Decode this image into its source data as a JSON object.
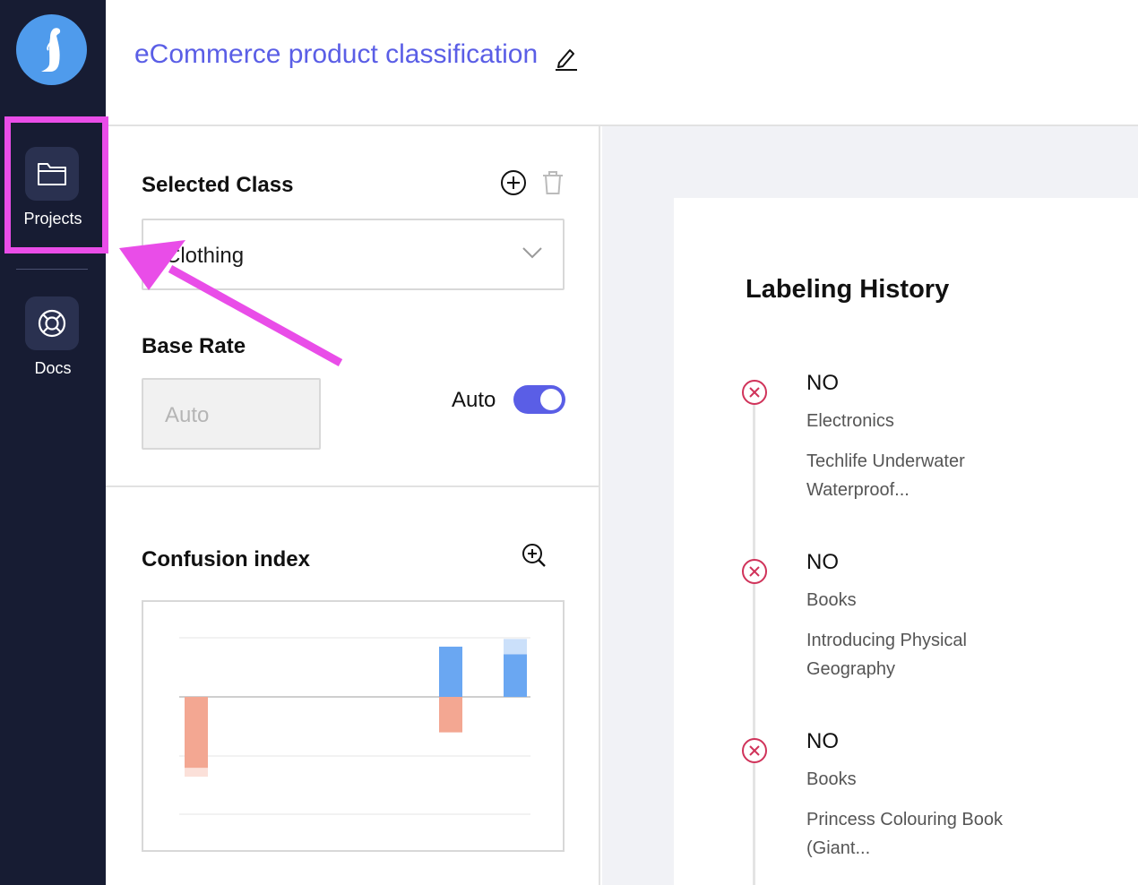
{
  "sidebar": {
    "nav": [
      {
        "label": "Projects",
        "icon": "folder-icon"
      },
      {
        "label": "Docs",
        "icon": "lifebuoy-icon"
      }
    ]
  },
  "header": {
    "title": "eCommerce product classification"
  },
  "selected_class": {
    "title": "Selected Class",
    "value": "Clothing"
  },
  "base_rate": {
    "title": "Base Rate",
    "placeholder": "Auto",
    "toggle_label": "Auto",
    "toggle_on": true
  },
  "confusion": {
    "title": "Confusion index"
  },
  "chart_data": {
    "type": "bar",
    "bars": [
      {
        "value": -1.2,
        "faint": -0.15,
        "color": "#f3a792"
      },
      {
        "value": 0.85,
        "faint": 0,
        "color": "#6aa7f2"
      },
      {
        "value": -0.6,
        "faint": 0,
        "color": "#f3a792"
      },
      {
        "value": 0.72,
        "faint": 0.26,
        "color": "#6aa7f2"
      }
    ]
  },
  "history": {
    "title": "Labeling History",
    "items": [
      {
        "verdict": "NO",
        "class": "Electronics",
        "name": "Techlife Underwater Waterproof..."
      },
      {
        "verdict": "NO",
        "class": "Books",
        "name": "Introducing Physical Geography"
      },
      {
        "verdict": "NO",
        "class": "Books",
        "name": "Princess Colouring Book (Giant..."
      }
    ]
  },
  "colors": {
    "accent": "#5a5ee6",
    "sidebar": "#171c33",
    "highlight": "#e94de8",
    "reject": "#d0335a"
  }
}
